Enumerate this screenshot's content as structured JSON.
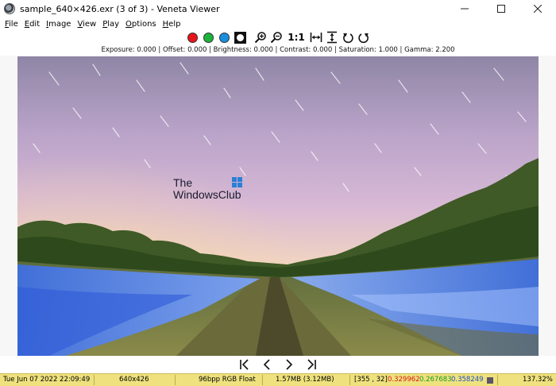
{
  "window": {
    "title": "sample_640×426.exr (3 of 3) - Veneta Viewer",
    "controls": [
      "minimize",
      "maximize",
      "close"
    ]
  },
  "menu": [
    {
      "underline": "F",
      "rest": "ile"
    },
    {
      "underline": "E",
      "rest": "dit"
    },
    {
      "underline": "I",
      "rest": "mage"
    },
    {
      "underline": "V",
      "rest": "iew"
    },
    {
      "underline": "P",
      "rest": "lay"
    },
    {
      "underline": "O",
      "rest": "ptions"
    },
    {
      "underline": "H",
      "rest": "elp"
    }
  ],
  "toolbar": {
    "channel_colors": {
      "red": "#e8141b",
      "green": "#1db33a",
      "blue": "#1a8fe0"
    },
    "icons": [
      "zoom-in-icon",
      "zoom-out-icon",
      "actual-size",
      "fit-width-icon",
      "fit-height-icon",
      "rotate-left-icon",
      "rotate-right-icon"
    ],
    "actual_size_label": "1:1"
  },
  "params_line": "Exposure: 0.000  |  Offset: 0.000  |  Brightness: 0.000  |  Contrast: 0.000  |  Saturation: 1.000  |  Gamma: 2.200",
  "watermark": {
    "line1": "The",
    "line2": "WindowsClub"
  },
  "navigation": [
    "first-image-icon",
    "previous-image-icon",
    "next-image-icon",
    "last-image-icon"
  ],
  "status": {
    "date": "Tue Jun 07 2022 22:09:49",
    "dimensions": "640x426",
    "format": "96bpp RGB Float",
    "size": "1.57MB (3.12MB)",
    "coords": "[355 , 32]",
    "r_value": "0.329962",
    "g_value": "0.267683",
    "b_value": "0.358249",
    "zoom": "137.32%",
    "colors": {
      "r": "#d81818",
      "g": "#189a20",
      "b": "#1a4fc8",
      "swatch": "#5c5468"
    }
  }
}
